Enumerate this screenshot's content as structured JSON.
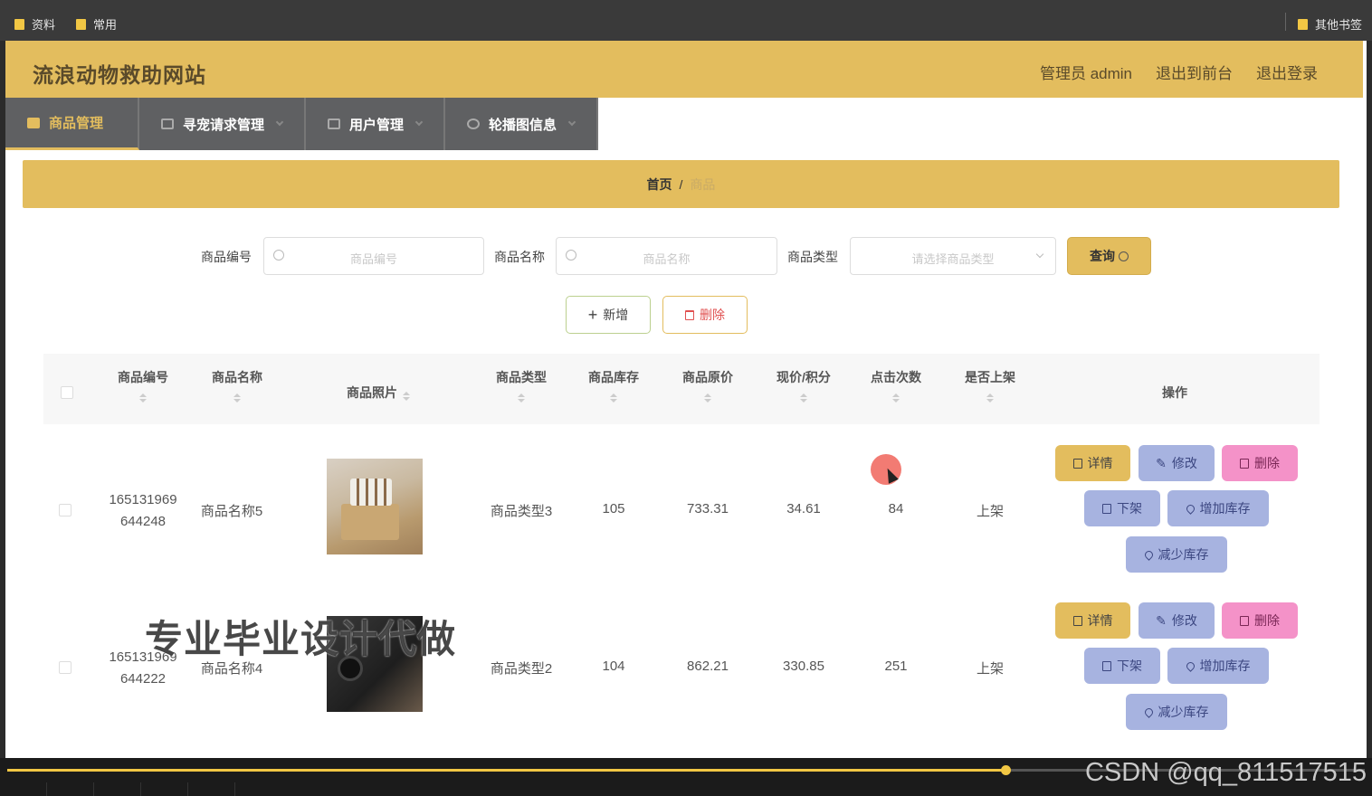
{
  "bookmarks": {
    "left": [
      "资料",
      "常用"
    ],
    "right": "其他书签"
  },
  "header": {
    "title": "流浪动物救助网站",
    "links": [
      "管理员 admin",
      "退出到前台",
      "退出登录"
    ]
  },
  "nav": [
    "商品管理",
    "寻宠请求管理",
    "用户管理",
    "轮播图信息"
  ],
  "breadcrumb": {
    "home": "首页",
    "sep": "/",
    "current": "商品"
  },
  "search": {
    "code_label": "商品编号",
    "code_placeholder": "商品编号",
    "name_label": "商品名称",
    "name_placeholder": "商品名称",
    "type_label": "商品类型",
    "type_placeholder": "请选择商品类型",
    "query_label": "查询"
  },
  "actions": {
    "add": "新增",
    "delete": "删除"
  },
  "table": {
    "headers": [
      "商品编号",
      "商品名称",
      "商品照片",
      "商品类型",
      "商品库存",
      "商品原价",
      "现价/积分",
      "点击次数",
      "是否上架",
      "操作"
    ],
    "rows": [
      {
        "code_line1": "165131969",
        "code_line2": "644248",
        "name": "商品名称5",
        "type": "商品类型3",
        "stock": "105",
        "orig_price": "733.31",
        "price": "34.61",
        "clicks": "84",
        "status": "上架"
      },
      {
        "code_line1": "165131969",
        "code_line2": "644222",
        "name": "商品名称4",
        "type": "商品类型2",
        "stock": "104",
        "orig_price": "862.21",
        "price": "330.85",
        "clicks": "251",
        "status": "上架"
      }
    ],
    "row_ops": {
      "detail": "详情",
      "edit": "修改",
      "delete": "删除",
      "offshelf": "下架",
      "add_stock": "增加库存",
      "reduce_stock": "减少库存"
    }
  },
  "watermark": "专业毕业设计代做",
  "video": {
    "progress": 0.735,
    "csdn": "CSDN @qq_811517515"
  },
  "colors": {
    "accent": "#e3bd5e",
    "nav_bg": "#5f6062",
    "btn_blue": "#a7b3e0",
    "btn_pink": "#f492c8"
  }
}
